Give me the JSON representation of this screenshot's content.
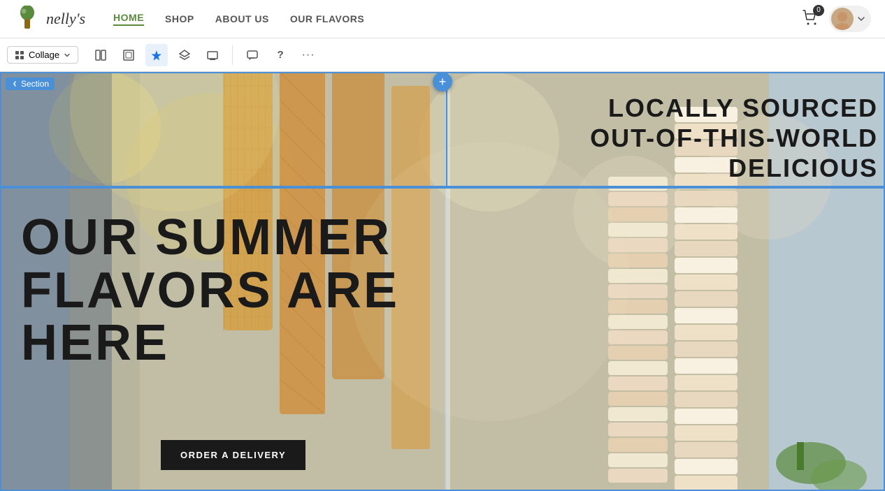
{
  "brand": {
    "name": "nelly's",
    "logo_alt": "ice cream logo"
  },
  "navbar": {
    "links": [
      {
        "label": "HOME",
        "active": true
      },
      {
        "label": "SHOP",
        "active": false
      },
      {
        "label": "ABOUT US",
        "active": false
      },
      {
        "label": "OUR FLAVORS",
        "active": false
      }
    ],
    "cart_count": "0",
    "user_label": "user account"
  },
  "editor_toolbar": {
    "view_mode_label": "Collage",
    "buttons": [
      {
        "id": "panel-btn",
        "icon": "⊞",
        "tooltip": "Panel view"
      },
      {
        "id": "split-btn",
        "icon": "⬜",
        "tooltip": "Split view"
      },
      {
        "id": "ai-btn",
        "icon": "✦",
        "tooltip": "AI tools",
        "active": true
      },
      {
        "id": "layers-btn",
        "icon": "◈",
        "tooltip": "Layers"
      },
      {
        "id": "preview-btn",
        "icon": "◱",
        "tooltip": "Preview"
      },
      {
        "id": "comment-btn",
        "icon": "◻",
        "tooltip": "Comment"
      },
      {
        "id": "help-btn",
        "icon": "?",
        "tooltip": "Help"
      },
      {
        "id": "more-btn",
        "icon": "···",
        "tooltip": "More"
      }
    ]
  },
  "section_label": "Section",
  "add_section_icon": "+",
  "hero": {
    "tag_right_line1": "LOCALLY SOURCED",
    "tag_right_line2": "OUT-OF-THIS-WORLD DELICIOUS",
    "headline_line1": "OUR SUMMER",
    "headline_line2": "FLAVORS ARE",
    "headline_line3": "HERE",
    "cta_button": "ORDER A DELIVERY"
  },
  "colors": {
    "accent_blue": "#4a90d9",
    "nav_green": "#5a8a3c",
    "hero_bg": "#b8a888",
    "text_dark": "#1a1a1a",
    "cta_bg": "#1a1a1a",
    "cta_text": "#ffffff"
  }
}
